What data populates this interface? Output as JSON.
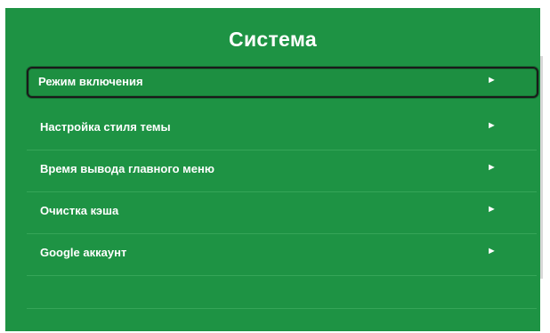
{
  "screen": {
    "title": "Система",
    "background_color": "#1e9344"
  },
  "menu": {
    "focused_index": 0,
    "items": [
      {
        "label": "Режим включения",
        "arrow": "►"
      },
      {
        "label": "Настройка стиля темы",
        "arrow": "►"
      },
      {
        "label": "Время вывода главного меню",
        "arrow": "►"
      },
      {
        "label": "Очистка кэша",
        "arrow": "►"
      },
      {
        "label": "Google аккаунт",
        "arrow": "►"
      }
    ]
  }
}
